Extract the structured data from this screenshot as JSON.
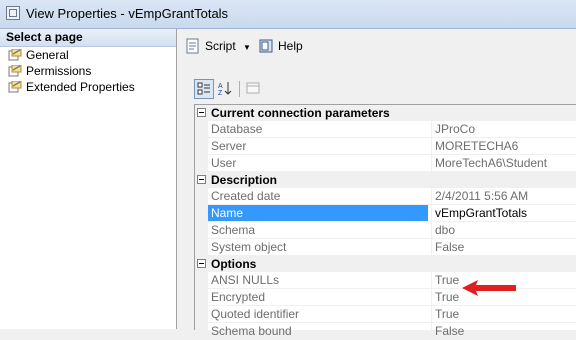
{
  "window": {
    "title": "View Properties - vEmpGrantTotals"
  },
  "left_pane": {
    "header": "Select a page",
    "items": [
      {
        "label": "General",
        "icon": "page-wrench-icon"
      },
      {
        "label": "Permissions",
        "icon": "page-wrench-icon"
      },
      {
        "label": "Extended Properties",
        "icon": "page-wrench-icon"
      }
    ]
  },
  "toolbar": {
    "script_label": "Script",
    "help_label": "Help"
  },
  "grid": {
    "categories": [
      {
        "label": "Current connection parameters",
        "rows": [
          {
            "key": "Database",
            "value": "JProCo"
          },
          {
            "key": "Server",
            "value": "MORETECHA6"
          },
          {
            "key": "User",
            "value": "MoreTechA6\\Student"
          }
        ]
      },
      {
        "label": "Description",
        "rows": [
          {
            "key": "Created date",
            "value": "2/4/2011 5:56 AM"
          },
          {
            "key": "Name",
            "value": "vEmpGrantTotals",
            "selected": true
          },
          {
            "key": "Schema",
            "value": "dbo"
          },
          {
            "key": "System object",
            "value": "False"
          }
        ]
      },
      {
        "label": "Options",
        "rows": [
          {
            "key": "ANSI NULLs",
            "value": "True"
          },
          {
            "key": "Encrypted",
            "value": "True"
          },
          {
            "key": "Quoted identifier",
            "value": "True"
          },
          {
            "key": "Schema bound",
            "value": "False"
          }
        ]
      }
    ]
  },
  "colors": {
    "selection": "#3399ff",
    "annotation_arrow": "#e02020"
  }
}
